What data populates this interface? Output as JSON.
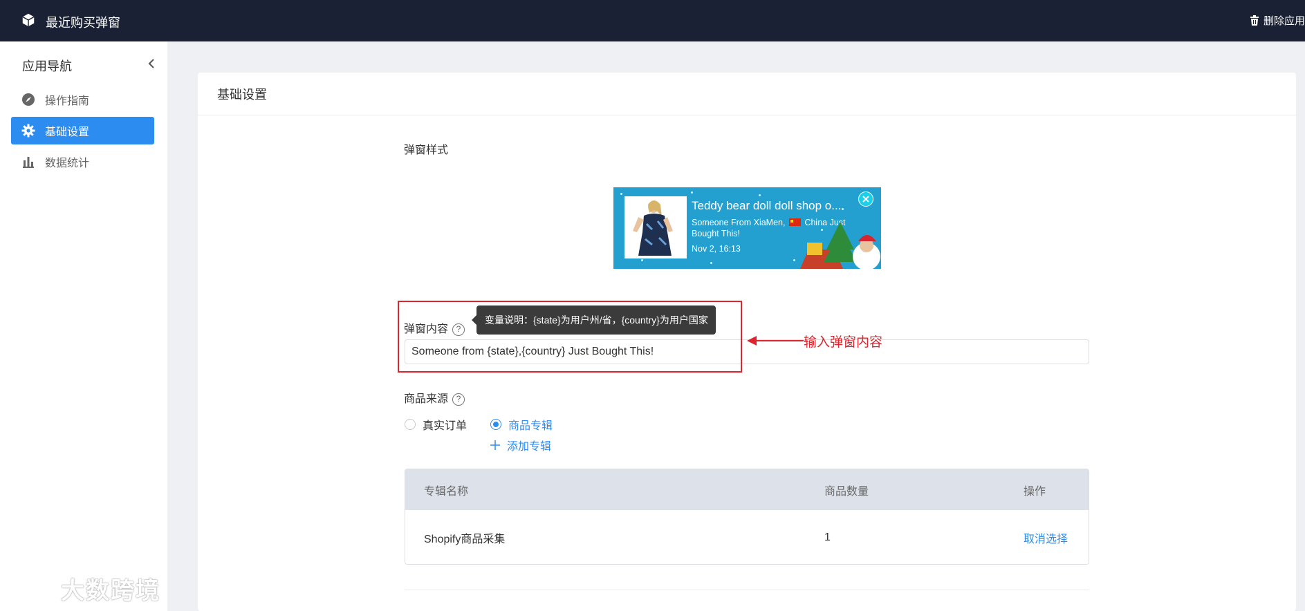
{
  "header": {
    "app_title": "最近购买弹窗",
    "delete_label": "删除应用"
  },
  "sidebar": {
    "title": "应用导航",
    "items": [
      {
        "label": "操作指南",
        "icon": "compass-icon"
      },
      {
        "label": "基础设置",
        "icon": "gear-icon",
        "active": true
      },
      {
        "label": "数据统计",
        "icon": "bar-chart-icon"
      }
    ]
  },
  "main": {
    "card_title": "基础设置",
    "popup_style_label": "弹窗样式",
    "preview": {
      "title": "Teddy bear doll doll shop o...",
      "line_prefix": "Someone From XiaMen,",
      "line_suffix": "China Just Bought This!",
      "time": "Nov 2, 16:13"
    },
    "popup_content": {
      "label": "弹窗内容",
      "tooltip": "变量说明：{state}为用户州/省，{country}为用户国家",
      "value": "Someone from {state},{country} Just Bought This!"
    },
    "annotation": "输入弹窗内容",
    "product_source": {
      "label": "商品来源",
      "options": [
        {
          "label": "真实订单",
          "checked": false
        },
        {
          "label": "商品专辑",
          "checked": true
        }
      ],
      "add_album": "添加专辑"
    },
    "table": {
      "headers": [
        "专辑名称",
        "商品数量",
        "操作"
      ],
      "rows": [
        {
          "name": "Shopify商品采集",
          "count": "1",
          "action": "取消选择"
        }
      ]
    }
  },
  "watermark": "大数跨境",
  "colors": {
    "topbar": "#1b2134",
    "primary": "#2d8cf0",
    "annotation_red": "#e0242e",
    "preview_bg": "#23a0d0"
  }
}
